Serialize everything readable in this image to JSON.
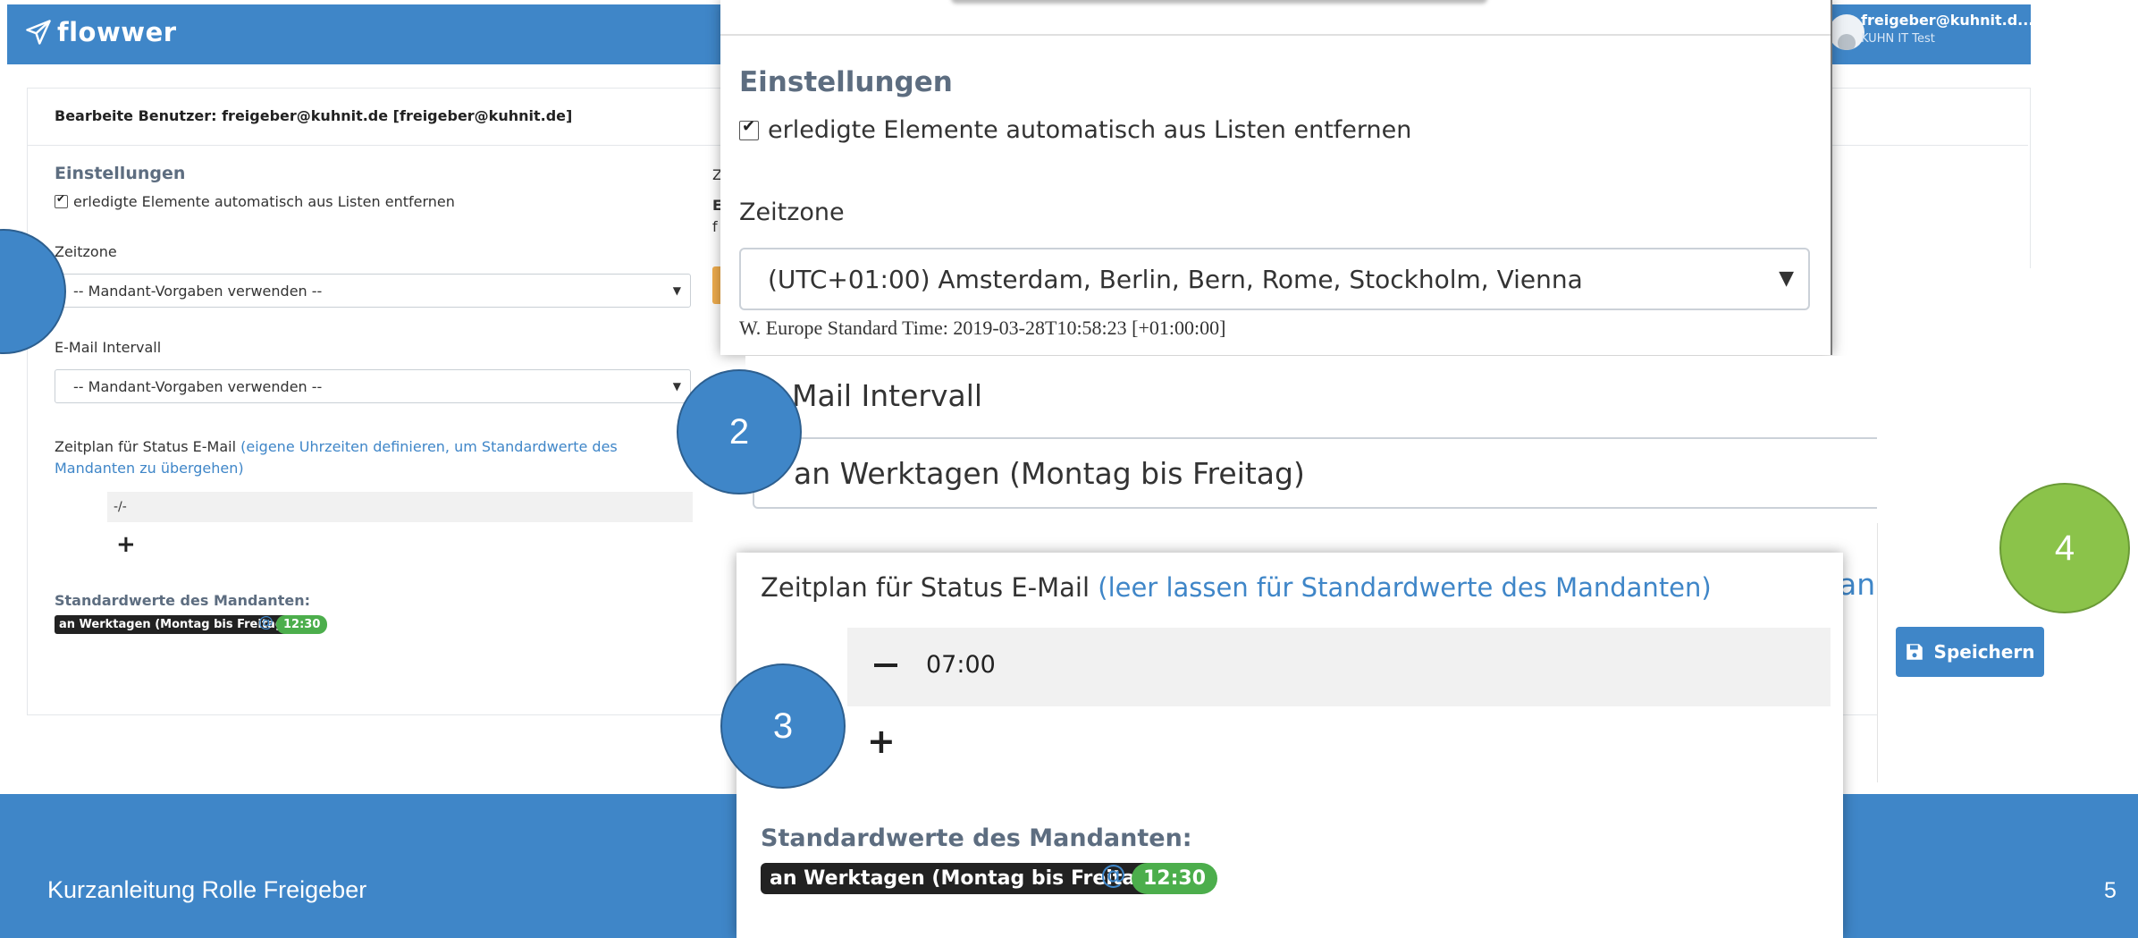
{
  "app": {
    "logo": "flowwer",
    "user_email": "freigeber@kuhnit.d...",
    "user_org": "KUHN IT Test"
  },
  "edit_user": {
    "title": "Bearbeite Benutzer: freigeber@kuhnit.de [freigeber@kuhnit.de]",
    "settings_heading": "Einstellungen",
    "auto_remove_label": "erledigte Elemente automatisch aus Listen entfernen",
    "timezone_label": "Zeitzone",
    "timezone_value": "-- Mandant-Vorgaben verwenden --",
    "email_interval_label": "E-Mail Intervall",
    "email_interval_value": "-- Mandant-Vorgaben verwenden --",
    "schedule_label": "Zeitplan für Status E-Mail",
    "schedule_hint": "(eigene Uhrzeiten definieren, um Standardwerte des Mandanten zu übergehen)",
    "schedule_empty": "-/-",
    "add_symbol": "+",
    "defaults_heading": "Standardwerte des Mandanten:",
    "defaults_days": "an Werktagen (Montag bis Freitag)",
    "defaults_at": "@",
    "defaults_time": "12:30",
    "right_col_a": "Z",
    "right_col_b": "E",
    "right_col_c": "f"
  },
  "zoom1": {
    "settings_heading": "Einstellungen",
    "auto_remove_label": "erledigte Elemente automatisch aus Listen entfernen",
    "timezone_label": "Zeitzone",
    "timezone_value": "(UTC+01:00) Amsterdam, Berlin, Bern, Rome, Stockholm, Vienna",
    "timezone_info": "W. Europe Standard Time: 2019-03-28T10:58:23 [+01:00:00]"
  },
  "zoom2": {
    "email_interval_label": "Mail Intervall",
    "email_interval_value": "an Werktagen (Montag bis Freitag)"
  },
  "zoom3": {
    "schedule_label": "Zeitplan für Status E-Mail",
    "schedule_hint": "(leer lassen für Standardwerte des Mandanten)",
    "slot_time": "07:00",
    "add_symbol": "+",
    "defaults_heading": "Standardwerte des Mandanten:",
    "defaults_days": "an Werktagen (Montag bis Freitag)",
    "defaults_at": "@",
    "defaults_time": "12:30"
  },
  "zoom4": {
    "fragment": "an",
    "save_label": "Speichern"
  },
  "callouts": [
    "2",
    "3",
    "4"
  ],
  "footer": {
    "title": "Kurzanleitung Rolle Freigeber",
    "page": "5"
  },
  "colors": {
    "brand_blue": "#3f86c8",
    "success_green": "#4cae4c",
    "callout_green": "#8bc34a"
  }
}
